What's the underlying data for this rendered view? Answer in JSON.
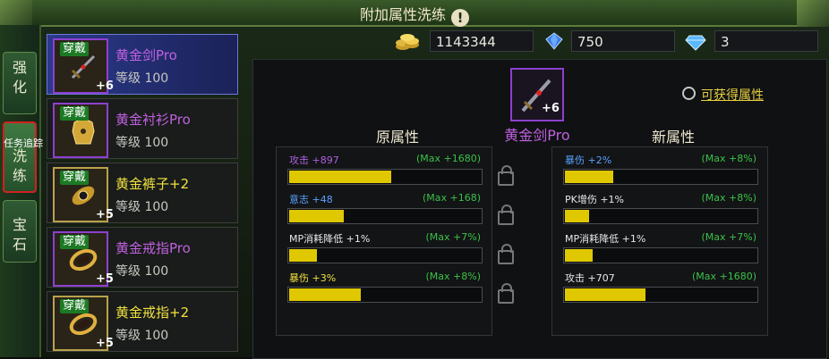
{
  "window": {
    "title": "附加属性洗练"
  },
  "side_tabs": [
    {
      "label": "强化",
      "active": false
    },
    {
      "label": "洗练",
      "active": true
    },
    {
      "label": "宝石",
      "active": false
    }
  ],
  "side_overlay_text": "任务追踪",
  "items": [
    {
      "badge": "穿戴",
      "name": "黄金剑Pro",
      "level": "等级 100",
      "plus": "+6",
      "name_color": "#c060e0",
      "icon": "sword-icon",
      "selected": true
    },
    {
      "badge": "穿戴",
      "name": "黄金衬衫Pro",
      "level": "等级 100",
      "plus": "",
      "name_color": "#c060e0",
      "icon": "armor-icon",
      "selected": false
    },
    {
      "badge": "穿戴",
      "name": "黄金裤子+2",
      "level": "等级 100",
      "plus": "+5",
      "name_color": "#f0e040",
      "icon": "pants-icon",
      "selected": false
    },
    {
      "badge": "穿戴",
      "name": "黄金戒指Pro",
      "level": "等级 100",
      "plus": "+5",
      "name_color": "#c060e0",
      "icon": "ring-icon",
      "selected": false
    },
    {
      "badge": "穿戴",
      "name": "黄金戒指+2",
      "level": "等级 100",
      "plus": "+5",
      "name_color": "#f0e040",
      "icon": "ring-icon",
      "selected": false
    }
  ],
  "currency": {
    "gold": {
      "icon": "gold-coins-icon",
      "value": "1143344"
    },
    "crystal": {
      "icon": "crystal-icon",
      "value": "750"
    },
    "diamond": {
      "icon": "diamond-icon",
      "value": "3"
    }
  },
  "selected_item": {
    "name": "黄金剑Pro",
    "plus": "+6",
    "icon": "sword-icon"
  },
  "obtain_link": "可获得属性",
  "original": {
    "heading": "原属性",
    "rows": [
      {
        "label": "攻击 +897",
        "max": "(Max +1680)",
        "fraction": 0.534,
        "color": "#b060e0"
      },
      {
        "label": "意志 +48",
        "max": "(Max +168)",
        "fraction": 0.286,
        "color": "#5aa0ff"
      },
      {
        "label": "MP消耗降低 +1%",
        "max": "(Max +7%)",
        "fraction": 0.143,
        "color": "#e8e8e8"
      },
      {
        "label": "暴伤 +3%",
        "max": "(Max +8%)",
        "fraction": 0.375,
        "color": "#f0e040"
      }
    ]
  },
  "new": {
    "heading": "新属性",
    "rows": [
      {
        "label": "暴伤 +2%",
        "max": "(Max +8%)",
        "fraction": 0.25,
        "color": "#5aa0ff"
      },
      {
        "label": "PK增伤 +1%",
        "max": "(Max +8%)",
        "fraction": 0.125,
        "color": "#e8e8e8"
      },
      {
        "label": "MP消耗降低 +1%",
        "max": "(Max +7%)",
        "fraction": 0.143,
        "color": "#e8e8e8"
      },
      {
        "label": "攻击 +707",
        "max": "(Max +1680)",
        "fraction": 0.421,
        "color": "#e8e8e8"
      }
    ]
  }
}
